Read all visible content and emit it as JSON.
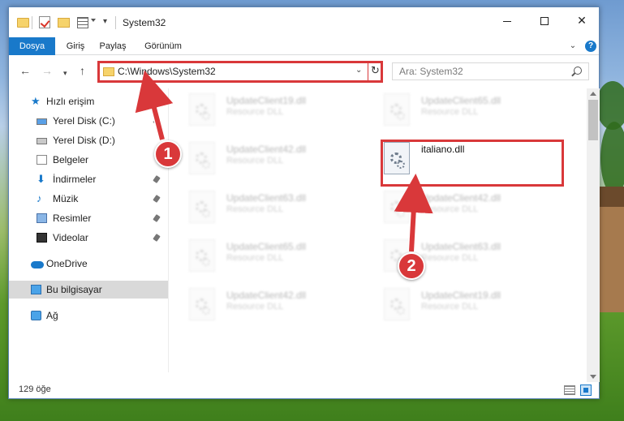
{
  "window": {
    "title": "System32",
    "tabs": [
      "Dosya",
      "Giriş",
      "Paylaş",
      "Görünüm"
    ]
  },
  "nav": {
    "address": "C:\\Windows\\System32",
    "search_placeholder": "Ara: System32"
  },
  "sidebar": {
    "items": [
      {
        "label": "Hızlı erişim",
        "icon": "star-icon"
      },
      {
        "label": "Yerel Disk (C:)",
        "icon": "drive-icon"
      },
      {
        "label": "Yerel Disk (D:)",
        "icon": "drive-icon"
      },
      {
        "label": "Belgeler",
        "icon": "documents-icon"
      },
      {
        "label": "İndirmeler",
        "icon": "download-icon"
      },
      {
        "label": "Müzik",
        "icon": "music-icon"
      },
      {
        "label": "Resimler",
        "icon": "pictures-icon"
      },
      {
        "label": "Videolar",
        "icon": "videos-icon"
      },
      {
        "label": "OneDrive",
        "icon": "cloud-icon"
      },
      {
        "label": "Bu bilgisayar",
        "icon": "computer-icon"
      },
      {
        "label": "Ağ",
        "icon": "network-icon"
      }
    ]
  },
  "files": [
    {
      "name": "UpdateClient19.dll",
      "type": "Resource DLL"
    },
    {
      "name": "UpdateClient65.dll",
      "type": "Resource DLL"
    },
    {
      "name": "UpdateClient42.dll",
      "type": "Resource DLL"
    },
    {
      "name": "italiano.dll",
      "type": ""
    },
    {
      "name": "UpdateClient63.dll",
      "type": "Resource DLL"
    },
    {
      "name": "UpdateClient42.dll",
      "type": "Resource DLL"
    },
    {
      "name": "UpdateClient65.dll",
      "type": "Resource DLL"
    },
    {
      "name": "UpdateClient63.dll",
      "type": "Resource DLL"
    },
    {
      "name": "UpdateClient42.dll",
      "type": "Resource DLL"
    },
    {
      "name": "UpdateClient19.dll",
      "type": "Resource DLL"
    }
  ],
  "status": {
    "item_count": "129 öğe"
  },
  "annotations": {
    "marker1": "1",
    "marker2": "2",
    "color": "#d9383a"
  },
  "colors": {
    "accent": "#1979ca",
    "highlight": "#d9383a"
  }
}
